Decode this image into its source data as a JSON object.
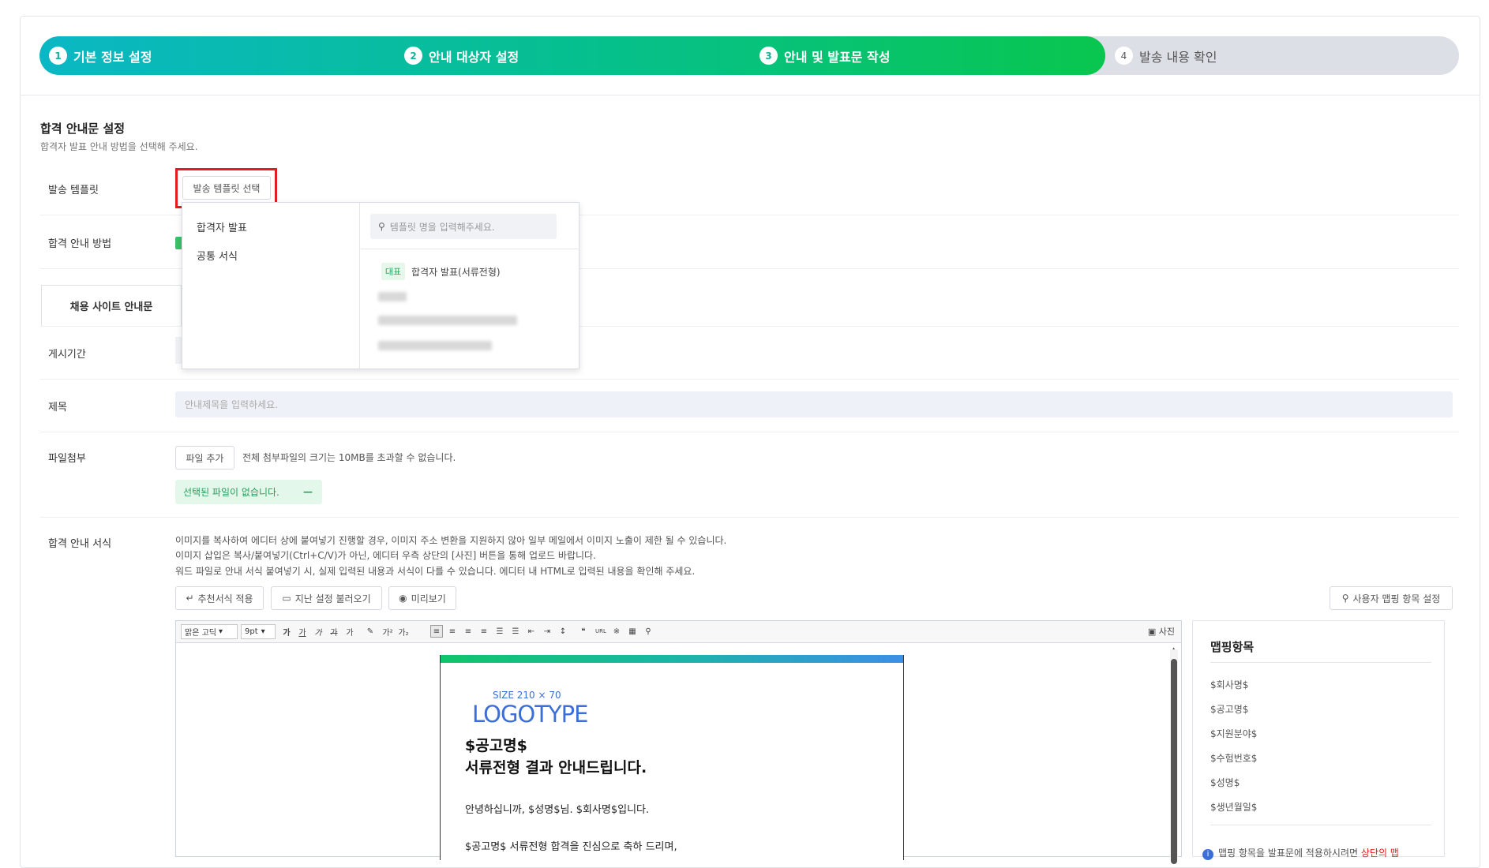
{
  "stepper": {
    "steps": [
      {
        "num": "1",
        "label": "기본 정보 설정"
      },
      {
        "num": "2",
        "label": "안내 대상자 설정"
      },
      {
        "num": "3",
        "label": "안내 및 발표문 작성"
      },
      {
        "num": "4",
        "label": "발송 내용 확인"
      }
    ],
    "current_step": 3
  },
  "section": {
    "title": "합격 안내문 설정",
    "desc": "합격자 발표 안내 방법을 선택해 주세요."
  },
  "labels": {
    "template": "발송 템플릿",
    "method": "합격 안내 방법",
    "period": "게시기간",
    "subject": "제목",
    "attach": "파일첨부",
    "format": "합격 안내 서식"
  },
  "template_button": "발송 템플릿 선택",
  "dropdown": {
    "categories": [
      "합격자 발표",
      "공통 서식"
    ],
    "search_placeholder": "템플릿 명을 입력해주세요.",
    "badge": "대표",
    "item": "합격자 발표(서류전형)"
  },
  "tab_label": "채용 사이트 안내문",
  "subject_placeholder": "안내제목을 입력하세요.",
  "attach": {
    "button": "파일 추가",
    "note": "전체 첨부파일의 크기는 10MB를 초과할 수 없습니다.",
    "empty": "선택된 파일이 없습니다.",
    "remove": "—"
  },
  "notes": [
    "이미지를 복사하여 에디터 상에 붙여넣기 진행할 경우, 이미지 주소 변환을 지원하지 않아 일부 메일에서 이미지 노출이 제한 될 수 있습니다.",
    "이미지 삽입은 복사/붙여넣기(Ctrl+C/V)가 아닌, 에디터 우측 상단의 [사진] 버튼을 통해 업로드 바랍니다.",
    "워드 파일로 안내 서식 붙여넣기 시, 실제 입력된 내용과 서식이 다를 수 있습니다. 에디터 내 HTML로 입력된 내용을 확인해 주세요."
  ],
  "actions": {
    "recommend": "추천서식 적용",
    "load": "지난 설정 불러오기",
    "preview": "미리보기",
    "mapping_settings": "사용자 맵핑 항목 설정"
  },
  "editor": {
    "font": "맑은 고딕",
    "size": "9pt",
    "photo": "사진",
    "doc": {
      "logo_size": "SIZE 210 × 70",
      "logo": "LOGOTYPE",
      "heading1": "$공고명$",
      "heading2": "서류전형 결과 안내드립니다.",
      "p1": "안녕하십니까, $성명$님. $회사명$입니다.",
      "p2": "$공고명$ 서류전형 합격을 진심으로 축하 드리며,"
    }
  },
  "mapping": {
    "title": "맵핑항목",
    "items": [
      "$회사명$",
      "$공고명$",
      "$지원분야$",
      "$수험번호$",
      "$성명$",
      "$생년월일$"
    ],
    "info": "맵핑 항목을 발표문에 적용하시려면",
    "info_highlight": "상단의 맵"
  },
  "colors": {
    "accent": "#09c64f",
    "highlight_red": "#e31b23",
    "logo_blue": "#3b6fd6"
  }
}
